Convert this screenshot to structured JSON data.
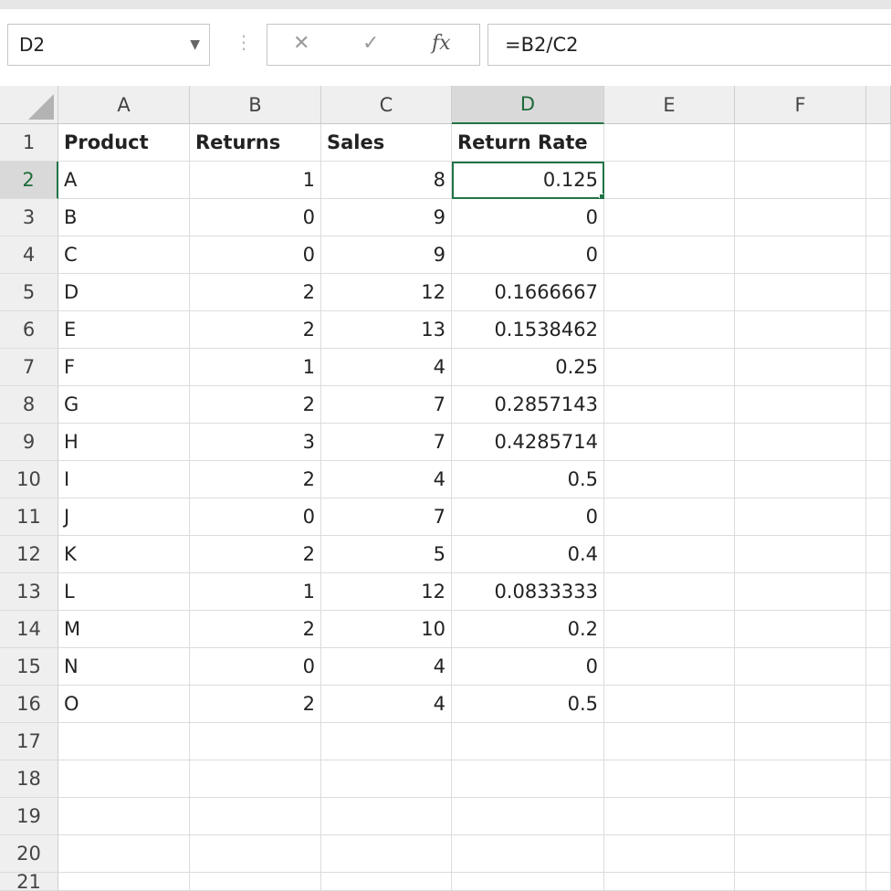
{
  "name_box": "D2",
  "formula": "=B2/C2",
  "fx_label": "fx",
  "cancel_symbol": "✕",
  "enter_symbol": "✓",
  "columns": [
    "A",
    "B",
    "C",
    "D",
    "E",
    "F"
  ],
  "header_row": {
    "num": "1",
    "a": "Product",
    "b": "Returns",
    "c": "Sales",
    "d": "Return Rate"
  },
  "rows": [
    {
      "num": "2",
      "a": "A",
      "b": "1",
      "c": "8",
      "d": "0.125"
    },
    {
      "num": "3",
      "a": "B",
      "b": "0",
      "c": "9",
      "d": "0"
    },
    {
      "num": "4",
      "a": "C",
      "b": "0",
      "c": "9",
      "d": "0"
    },
    {
      "num": "5",
      "a": "D",
      "b": "2",
      "c": "12",
      "d": "0.1666667"
    },
    {
      "num": "6",
      "a": "E",
      "b": "2",
      "c": "13",
      "d": "0.1538462"
    },
    {
      "num": "7",
      "a": "F",
      "b": "1",
      "c": "4",
      "d": "0.25"
    },
    {
      "num": "8",
      "a": "G",
      "b": "2",
      "c": "7",
      "d": "0.2857143"
    },
    {
      "num": "9",
      "a": "H",
      "b": "3",
      "c": "7",
      "d": "0.4285714"
    },
    {
      "num": "10",
      "a": "I",
      "b": "2",
      "c": "4",
      "d": "0.5"
    },
    {
      "num": "11",
      "a": "J",
      "b": "0",
      "c": "7",
      "d": "0"
    },
    {
      "num": "12",
      "a": "K",
      "b": "2",
      "c": "5",
      "d": "0.4"
    },
    {
      "num": "13",
      "a": "L",
      "b": "1",
      "c": "12",
      "d": "0.0833333"
    },
    {
      "num": "14",
      "a": "M",
      "b": "2",
      "c": "10",
      "d": "0.2"
    },
    {
      "num": "15",
      "a": "N",
      "b": "0",
      "c": "4",
      "d": "0"
    },
    {
      "num": "16",
      "a": "O",
      "b": "2",
      "c": "4",
      "d": "0.5"
    }
  ],
  "empty_rows": [
    "17",
    "18",
    "19",
    "20",
    "21"
  ],
  "colors": {
    "accent": "#217346",
    "header_bg": "#efefef",
    "gridline": "#dcdcdc"
  }
}
